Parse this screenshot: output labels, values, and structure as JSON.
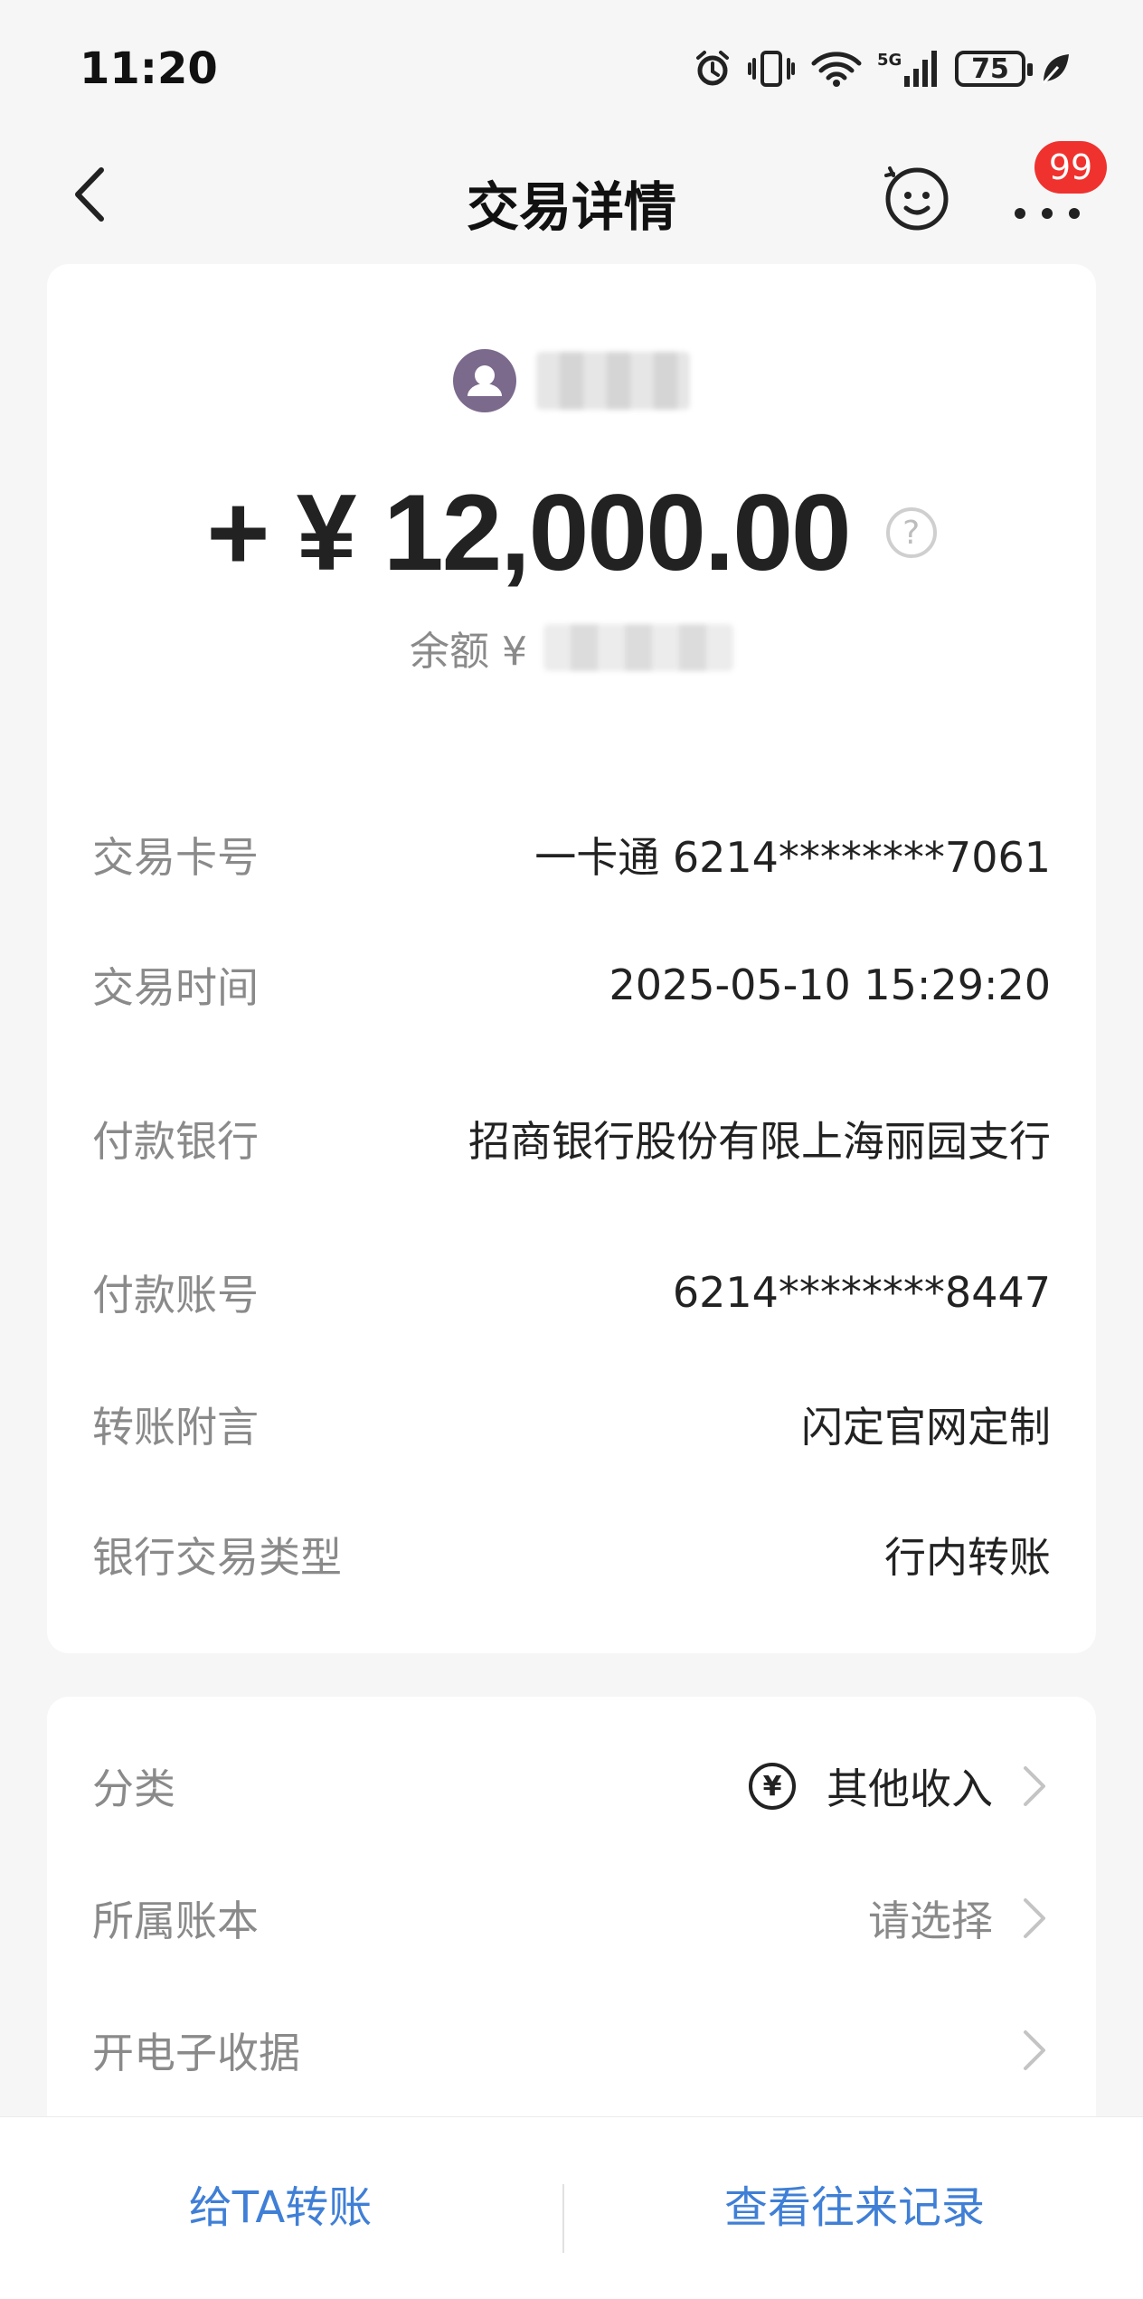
{
  "status_bar": {
    "time": "11:20",
    "battery": "75",
    "network": "5G"
  },
  "header": {
    "title": "交易详情",
    "badge": "99"
  },
  "summary": {
    "amount": "+ ¥ 12,000.00",
    "balance_label": "余额 ¥",
    "help": "?"
  },
  "details": [
    {
      "label": "交易卡号",
      "value": "一卡通 6214********7061"
    },
    {
      "label": "交易时间",
      "value": "2025-05-10 15:29:20"
    },
    {
      "label": "付款银行",
      "value": "招商银行股份有限上海丽园支行"
    },
    {
      "label": "付款账号",
      "value": "6214********8447"
    },
    {
      "label": "转账附言",
      "value": "闪定官网定制"
    },
    {
      "label": "银行交易类型",
      "value": "行内转账"
    }
  ],
  "settings": {
    "category_label": "分类",
    "category_value": "其他收入",
    "category_icon": "¥",
    "book_label": "所属账本",
    "book_placeholder": "请选择",
    "receipt_label": "开电子收据"
  },
  "bottom": {
    "transfer_label": "给TA转账",
    "history_label": "查看往来记录"
  },
  "colors": {
    "accent": "#3f7fd6",
    "badge": "#f0322e",
    "avatar": "#7b6a8c"
  }
}
